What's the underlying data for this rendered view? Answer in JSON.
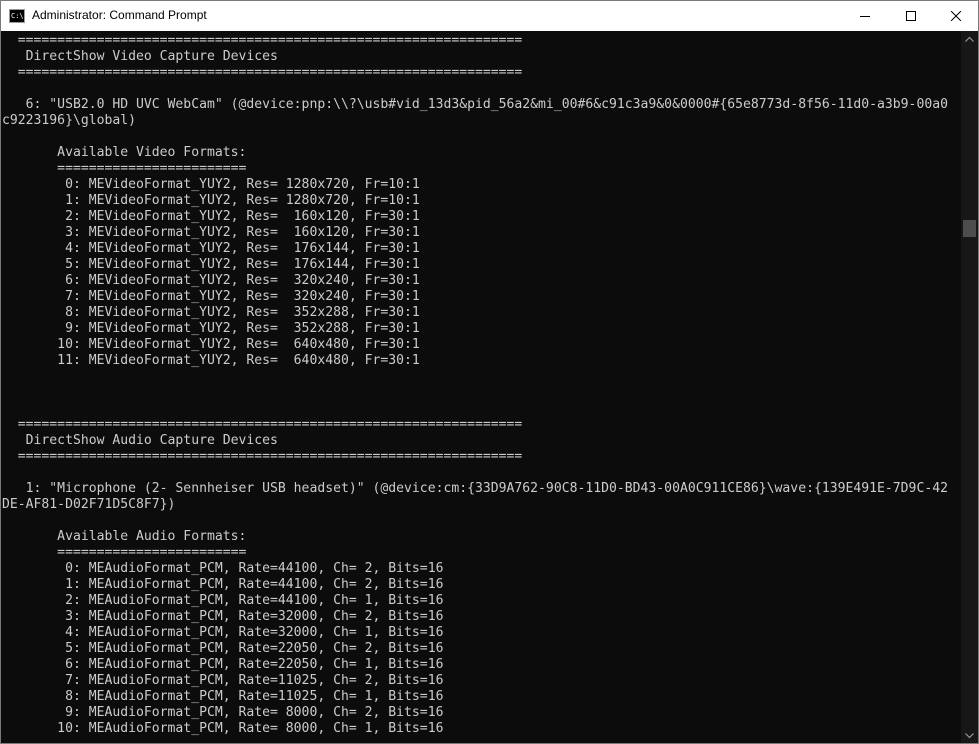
{
  "window": {
    "title": "Administrator: Command Prompt",
    "icon_text": "C:\\",
    "icons": {
      "app": "command-prompt-icon",
      "minimize": "minimize-icon",
      "maximize": "maximize-icon",
      "close": "close-icon",
      "scroll_up": "chevron-up-icon",
      "scroll_down": "chevron-down-icon"
    },
    "colors": {
      "console_background": "#0c0c0c",
      "console_text": "#cccccc",
      "titlebar": "#ffffff"
    }
  },
  "console": {
    "lines": [
      "  ================================================================",
      "   DirectShow Video Capture Devices",
      "  ================================================================",
      "",
      "   6: \"USB2.0 HD UVC WebCam\" (@device:pnp:\\\\?\\usb#vid_13d3&pid_56a2&mi_00#6&c91c3a9&0&0000#{65e8773d-8f56-11d0-a3b9-00a0",
      "c9223196}\\global)",
      "",
      "       Available Video Formats:",
      "       ========================",
      "        0: MEVideoFormat_YUY2, Res= 1280x720, Fr=10:1",
      "        1: MEVideoFormat_YUY2, Res= 1280x720, Fr=10:1",
      "        2: MEVideoFormat_YUY2, Res=  160x120, Fr=30:1",
      "        3: MEVideoFormat_YUY2, Res=  160x120, Fr=30:1",
      "        4: MEVideoFormat_YUY2, Res=  176x144, Fr=30:1",
      "        5: MEVideoFormat_YUY2, Res=  176x144, Fr=30:1",
      "        6: MEVideoFormat_YUY2, Res=  320x240, Fr=30:1",
      "        7: MEVideoFormat_YUY2, Res=  320x240, Fr=30:1",
      "        8: MEVideoFormat_YUY2, Res=  352x288, Fr=30:1",
      "        9: MEVideoFormat_YUY2, Res=  352x288, Fr=30:1",
      "       10: MEVideoFormat_YUY2, Res=  640x480, Fr=30:1",
      "       11: MEVideoFormat_YUY2, Res=  640x480, Fr=30:1",
      "",
      "",
      "",
      "  ================================================================",
      "   DirectShow Audio Capture Devices",
      "  ================================================================",
      "",
      "   1: \"Microphone (2- Sennheiser USB headset)\" (@device:cm:{33D9A762-90C8-11D0-BD43-00A0C911CE86}\\wave:{139E491E-7D9C-42",
      "DE-AF81-D02F71D5C8F7})",
      "",
      "       Available Audio Formats:",
      "       ========================",
      "        0: MEAudioFormat_PCM, Rate=44100, Ch= 2, Bits=16",
      "        1: MEAudioFormat_PCM, Rate=44100, Ch= 2, Bits=16",
      "        2: MEAudioFormat_PCM, Rate=44100, Ch= 1, Bits=16",
      "        3: MEAudioFormat_PCM, Rate=32000, Ch= 2, Bits=16",
      "        4: MEAudioFormat_PCM, Rate=32000, Ch= 1, Bits=16",
      "        5: MEAudioFormat_PCM, Rate=22050, Ch= 2, Bits=16",
      "        6: MEAudioFormat_PCM, Rate=22050, Ch= 1, Bits=16",
      "        7: MEAudioFormat_PCM, Rate=11025, Ch= 2, Bits=16",
      "        8: MEAudioFormat_PCM, Rate=11025, Ch= 1, Bits=16",
      "        9: MEAudioFormat_PCM, Rate= 8000, Ch= 2, Bits=16",
      "       10: MEAudioFormat_PCM, Rate= 8000, Ch= 1, Bits=16"
    ]
  }
}
